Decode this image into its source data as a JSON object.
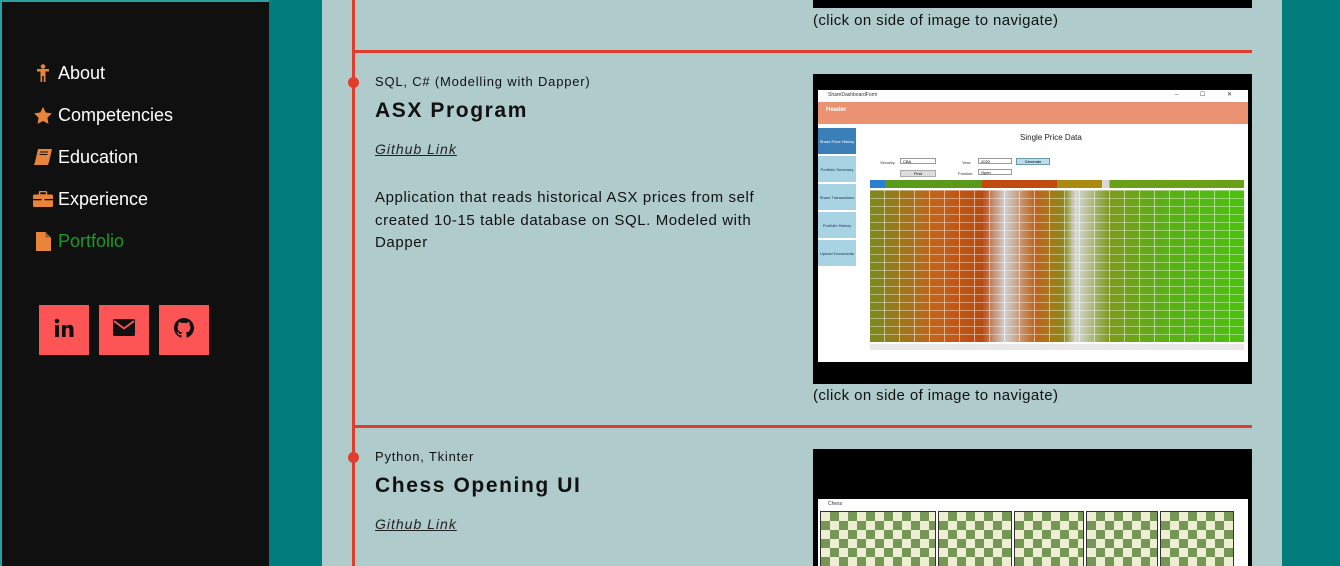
{
  "sidebar": {
    "nav": [
      {
        "label": "About",
        "icon": "person-icon",
        "active": false
      },
      {
        "label": "Competencies",
        "icon": "star-icon",
        "active": false
      },
      {
        "label": "Education",
        "icon": "book-icon",
        "active": false
      },
      {
        "label": "Experience",
        "icon": "briefcase-icon",
        "active": false
      },
      {
        "label": "Portfolio",
        "icon": "file-icon",
        "active": true
      }
    ],
    "social": [
      {
        "icon": "linkedin-icon"
      },
      {
        "icon": "envelope-icon"
      },
      {
        "icon": "github-icon"
      }
    ]
  },
  "colors": {
    "accent": "#e23c2d",
    "social_bg": "#fd5556",
    "sidebar_bg": "#101010",
    "page_bg": "#017d7e",
    "content_bg": "#b0cbcb",
    "active_nav": "#189a28"
  },
  "top_caption": "(click on side of image to navigate)",
  "projects": [
    {
      "tech": "SQL, C# (Modelling with Dapper)",
      "title": "ASX Program",
      "link": "Github Link",
      "description": "Application that reads historical ASX prices from self created 10-15 table database on SQL. Modeled with Dapper",
      "caption": "(click on side of image to navigate)",
      "screenshot": {
        "window_title": "ShareDashboardForm",
        "window_controls": "– ☐ ✕",
        "header": "Header",
        "page_title": "Single Price Data",
        "tabs": [
          "Share Price History",
          "Portfolio Summary",
          "Share Transactions",
          "Portfolio History",
          "Upload Documents"
        ],
        "security_label": "Security:",
        "security_value": "CBA",
        "year_label": "Year:",
        "year_value": "2020",
        "position_label": "Position:",
        "position_value": "Open",
        "generate": "Generate",
        "find": "Find"
      }
    },
    {
      "tech": "Python, Tkinter",
      "title": "Chess Opening UI",
      "link": "Github Link",
      "screenshot": {
        "window_title": "Chess"
      }
    }
  ]
}
